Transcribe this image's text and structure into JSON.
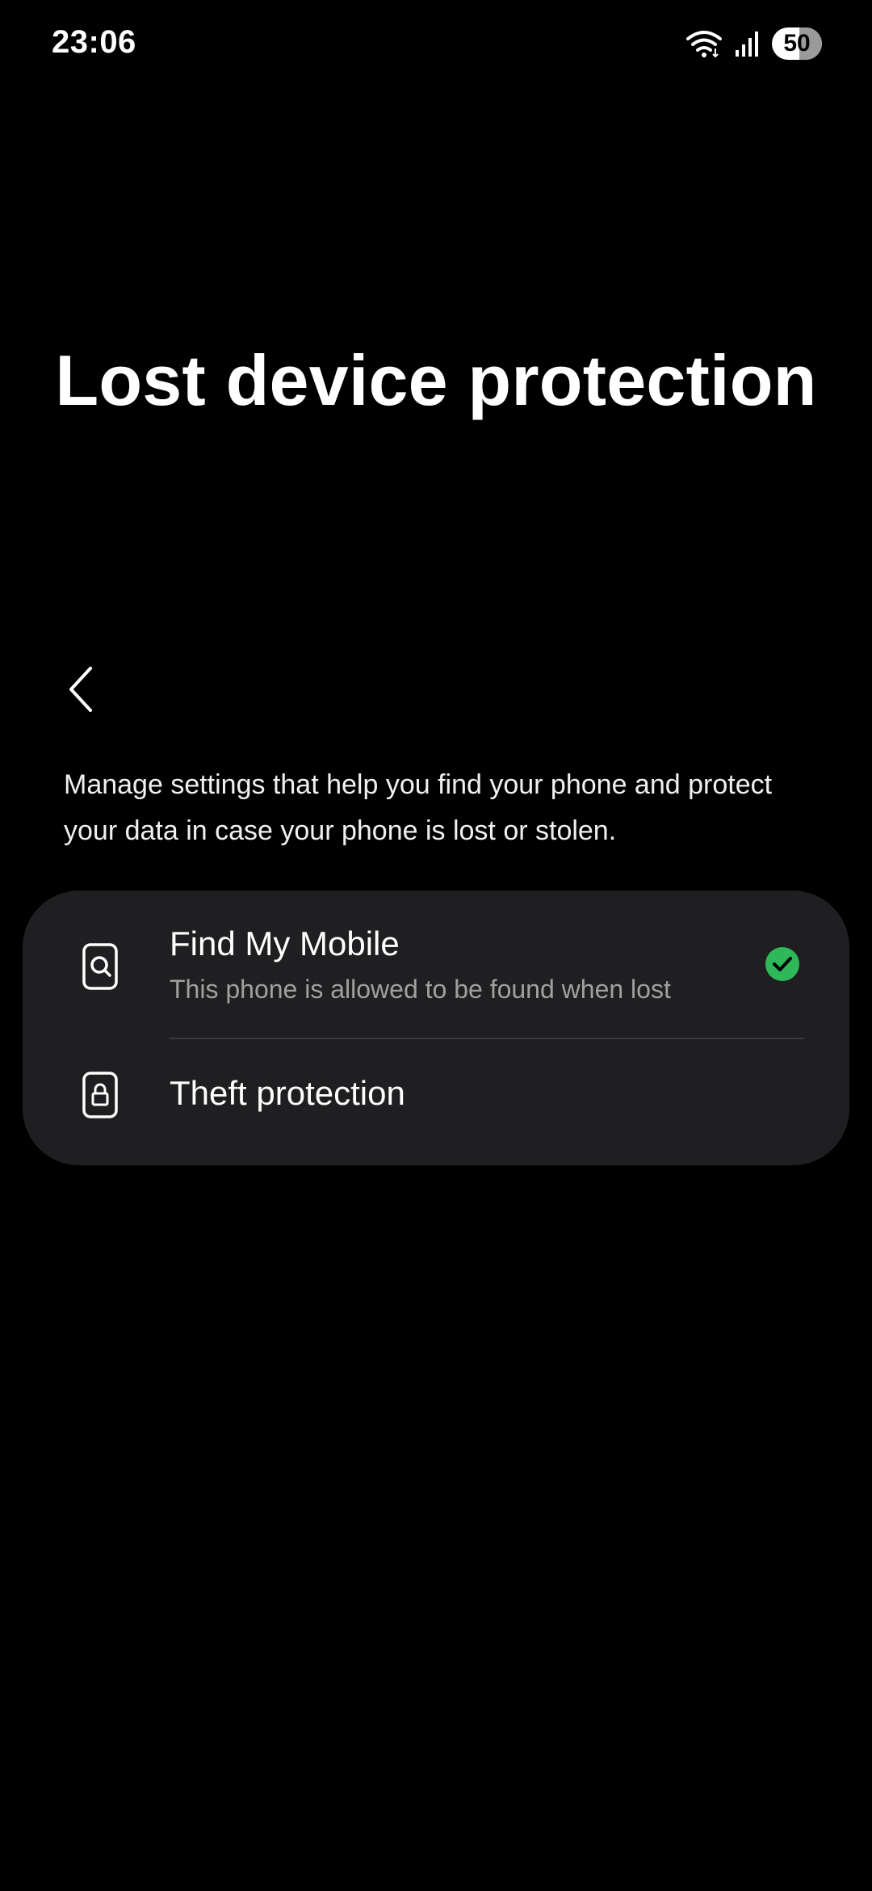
{
  "status_bar": {
    "time": "23:06",
    "battery": "50",
    "icons": [
      "wifi-icon",
      "signal-icon",
      "battery-icon"
    ]
  },
  "page": {
    "title": "Lost device protection",
    "description": "Manage settings that help you find your phone and protect your data in case your phone is lost or stolen."
  },
  "settings": {
    "items": [
      {
        "title": "Find My Mobile",
        "subtitle": "This phone is allowed to be found when lost",
        "icon": "phone-search-icon",
        "status_icon": "check-circle-icon"
      },
      {
        "title": "Theft protection",
        "icon": "phone-lock-icon"
      }
    ]
  },
  "colors": {
    "background": "#000000",
    "card": "#1f1f21",
    "check": "#2fb85a",
    "subtitle": "#a0a0a0"
  }
}
